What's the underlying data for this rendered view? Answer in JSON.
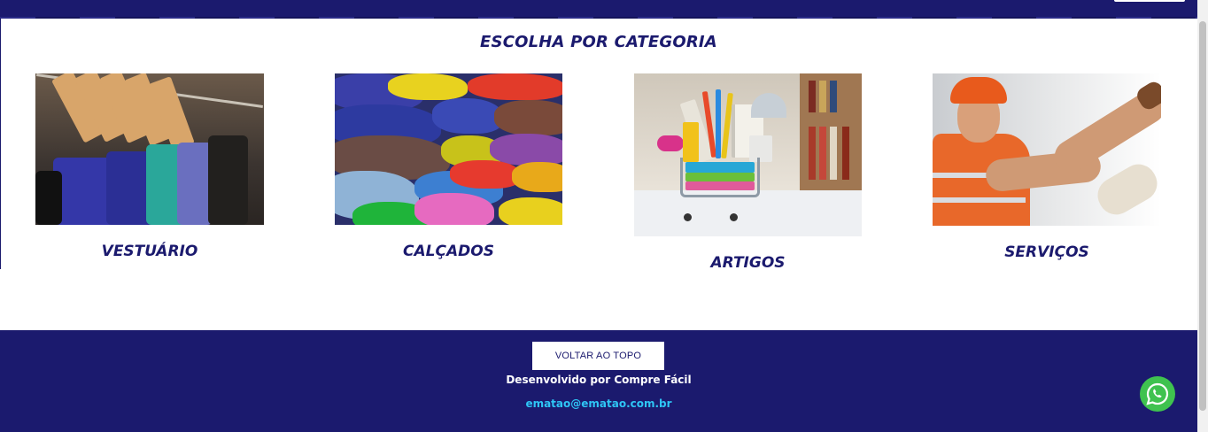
{
  "section": {
    "title": "ESCOLHA POR CATEGORIA"
  },
  "categories": [
    {
      "label": "VESTUÁRIO"
    },
    {
      "label": "CALÇADOS"
    },
    {
      "label": "ARTIGOS"
    },
    {
      "label": "SERVIÇOS"
    }
  ],
  "footer": {
    "back_to_top": "VOLTAR AO TOPO",
    "developed_by": "Desenvolvido por Compre Fácil",
    "email": "ematao@ematao.com.br"
  },
  "colors": {
    "brand": "#1b1a6e",
    "link": "#2ec5f5",
    "whatsapp": "#3fc24f"
  },
  "icons": {
    "whatsapp": "whatsapp-icon"
  }
}
